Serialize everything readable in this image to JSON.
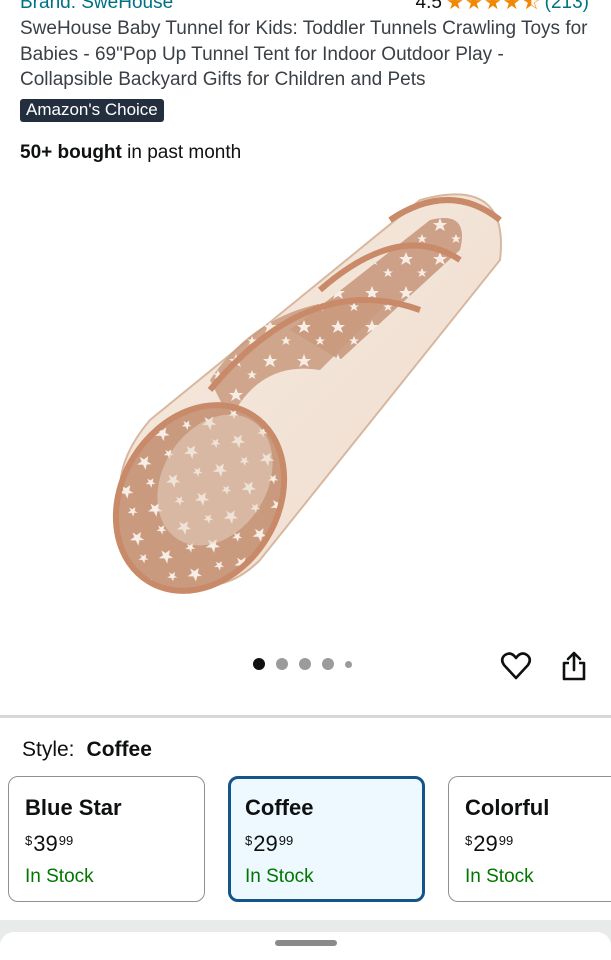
{
  "header": {
    "brand": "Brand: SweHouse",
    "rating": "4.5",
    "rating_stars": 4.5,
    "rating_count": "(213)"
  },
  "product": {
    "title": "SweHouse Baby Tunnel for Kids: Toddler Tunnels Crawling Toys for Babies - 69\"Pop Up Tunnel Tent for Indoor Outdoor Play - Collapsible Backyard Gifts for Children and Pets",
    "badge": "Amazon's Choice",
    "bought_bold": "50+ bought",
    "bought_rest": " in past month"
  },
  "gallery": {
    "image_count": 5,
    "active_index": 0
  },
  "icons": {
    "favorite": "heart-icon",
    "share": "share-icon"
  },
  "style": {
    "label": "Style:",
    "selected": "Coffee",
    "options": [
      {
        "name": "Blue Star",
        "currency": "$",
        "price_whole": "39",
        "price_cents": "99",
        "stock": "In Stock"
      },
      {
        "name": "Coffee",
        "currency": "$",
        "price_whole": "29",
        "price_cents": "99",
        "stock": "In Stock"
      },
      {
        "name": "Colorful",
        "currency": "$",
        "price_whole": "29",
        "price_cents": "99",
        "stock": "In Stock"
      }
    ]
  },
  "colors": {
    "link": "#007185",
    "star": "#f08804",
    "badge_bg": "#232f3e",
    "stock_green": "#007600",
    "selected_border": "#14548a",
    "selected_bg": "#edf8ff"
  }
}
